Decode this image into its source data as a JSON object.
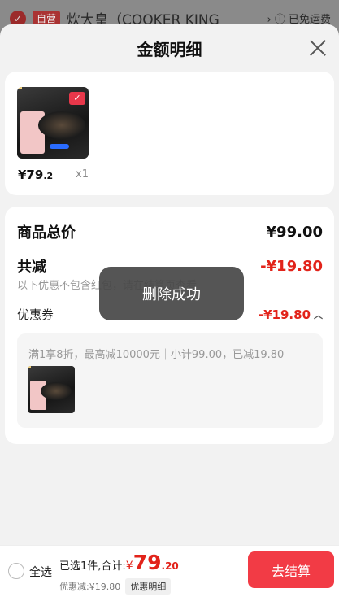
{
  "background": {
    "store_badge": "自营",
    "store_name": "炊大皇（COOKER KING",
    "shipping": "已免运费"
  },
  "sheet": {
    "title": "金额明细"
  },
  "product": {
    "price_int": "¥79",
    "price_dec": ".2",
    "qty": "x1"
  },
  "detail": {
    "total_label": "商品总价",
    "total_value": "¥99.00",
    "discount_label": "共减",
    "discount_value": "-¥19.80",
    "note": "以下优惠不包含红包，请在结算页查看",
    "coupon_label": "优惠券",
    "coupon_value": "-¥19.80",
    "coupon_desc": "满1享8折，最高减10000元｜小计99.00，已减19.80"
  },
  "toast": {
    "text": "删除成功"
  },
  "bottom": {
    "select_all": "全选",
    "selected_summary": "已选1件,合计:",
    "currency": "¥",
    "total_int": "79",
    "total_dec": ".20",
    "discount_summary": "优惠减:¥19.80",
    "detail_button": "优惠明细",
    "checkout_button": "去结算"
  },
  "colors": {
    "accent_red": "#e2231a",
    "checkout_bg": "#f23b45"
  }
}
